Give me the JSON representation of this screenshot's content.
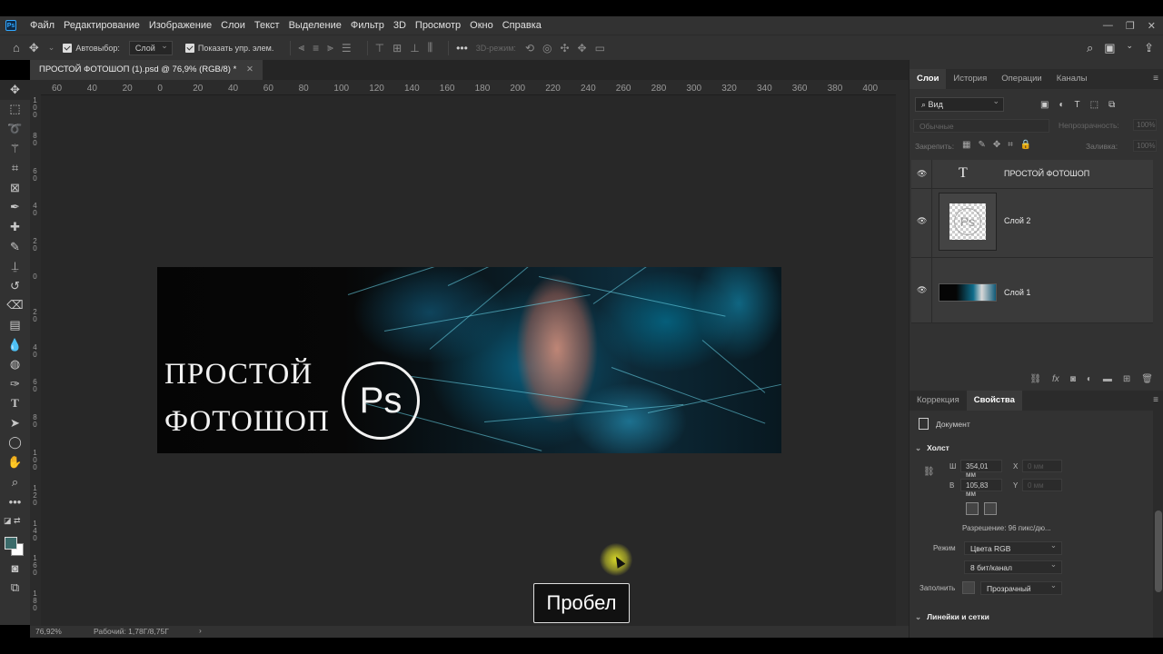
{
  "menubar": {
    "items": [
      "Файл",
      "Редактирование",
      "Изображение",
      "Слои",
      "Текст",
      "Выделение",
      "Фильтр",
      "3D",
      "Просмотр",
      "Окно",
      "Справка"
    ]
  },
  "options": {
    "autoselect_label": "Автовыбор:",
    "autoselect_value": "Слой",
    "show_controls_label": "Показать упр. элем.",
    "mode_3d_label": "3D-режим:"
  },
  "document": {
    "tab_title": "ПРОСТОЙ ФОТОШОП (1).psd @ 76,9% (RGB/8) *",
    "zoom": "76,92%",
    "status": "Рабочий: 1,78Г/8,75Г"
  },
  "rulers": {
    "horizontal": [
      "60",
      "40",
      "20",
      "0",
      "20",
      "40",
      "60",
      "80",
      "100",
      "120",
      "140",
      "160",
      "180",
      "200",
      "220",
      "240",
      "260",
      "280",
      "300",
      "320",
      "340",
      "360",
      "380",
      "400"
    ],
    "vertical": [
      "1\n0\n0",
      "8\n0",
      "6\n0",
      "4\n0",
      "2\n0",
      "0",
      "2\n0",
      "4\n0",
      "6\n0",
      "8\n0",
      "1\n0\n0",
      "1\n2\n0",
      "1\n4\n0",
      "1\n6\n0",
      "1\n8\n0"
    ]
  },
  "artwork": {
    "line1": "ПРОСТОЙ",
    "line2": "ФОТОШОП",
    "logo_text": "Ps"
  },
  "keypress_overlay": "Пробел",
  "layers_panel": {
    "tabs": [
      "Слои",
      "История",
      "Операции",
      "Каналы"
    ],
    "filter_value": "Вид",
    "blend_mode": "Обычные",
    "opacity_label": "Непрозрачность:",
    "opacity_value": "100%",
    "lock_label": "Закрепить:",
    "fill_label": "Заливка:",
    "fill_value": "100%",
    "layers": [
      {
        "name": "ПРОСТОЙ ФОТОШОП",
        "type": "text"
      },
      {
        "name": "Слой 2",
        "type": "pixel"
      },
      {
        "name": "Слой 1",
        "type": "pixel"
      }
    ]
  },
  "properties_panel": {
    "tabs": [
      "Коррекция",
      "Свойства"
    ],
    "doc_label": "Документ",
    "canvas_section": "Холст",
    "width_label": "Ш",
    "width_value": "354,01 мм",
    "height_label": "В",
    "height_value": "105,83 мм",
    "x_label": "X",
    "x_value": "0 мм",
    "y_label": "Y",
    "y_value": "0 мм",
    "resolution": "Разрешение: 96 пикс/дю...",
    "mode_label": "Режим",
    "mode_value": "Цвета RGB",
    "depth_value": "8 бит/канал",
    "fill_label": "Заполнить",
    "fill_value": "Прозрачный",
    "rulers_section": "Линейки и сетки"
  },
  "colors": {
    "foreground": "#3b6b6a",
    "background": "#ffffff",
    "accent": "#31a8ff"
  }
}
